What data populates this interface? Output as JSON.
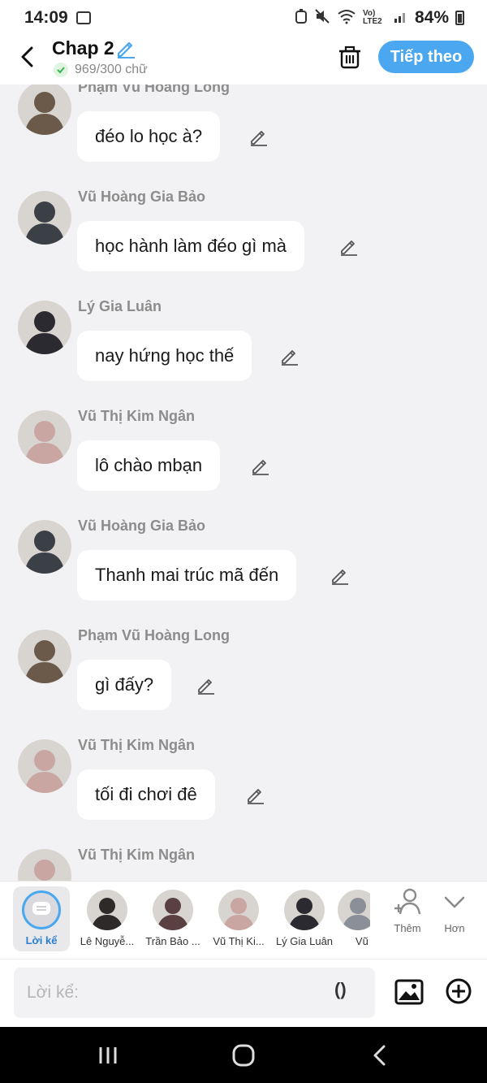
{
  "status_bar": {
    "time": "14:09",
    "network": "Vo) LTE2",
    "battery": "84%"
  },
  "header": {
    "title": "Chap 2",
    "word_count": "969/300 chữ",
    "next_label": "Tiếp theo"
  },
  "messages": [
    {
      "sender": "Phạm Vũ Hoàng Long",
      "text": "đéo lo học à?",
      "avatar_tone": "#6b5a4a"
    },
    {
      "sender": "Vũ Hoàng Gia Bảo",
      "text": "học hành làm đéo gì mà",
      "avatar_tone": "#3b3f46"
    },
    {
      "sender": "Lý Gia Luân",
      "text": "nay hứng học thế",
      "avatar_tone": "#2a2a30"
    },
    {
      "sender": "Vũ Thị Kim Ngân",
      "text": "lô chào mbạn",
      "avatar_tone": "#c9a6a1"
    },
    {
      "sender": "Vũ Hoàng Gia Bảo",
      "text": "Thanh mai trúc mã đến",
      "avatar_tone": "#3b3f46"
    },
    {
      "sender": "Phạm Vũ Hoàng Long",
      "text": "gì đấy?",
      "avatar_tone": "#6b5a4a"
    },
    {
      "sender": "Vũ Thị Kim Ngân",
      "text": "tối đi chơi đê",
      "avatar_tone": "#c9a6a1"
    },
    {
      "sender": "Vũ Thị Kim Ngân",
      "text": "",
      "avatar_tone": "#c9a6a1"
    }
  ],
  "character_bar": {
    "narrator_label": "Lời kể",
    "characters": [
      {
        "label": "Lê Nguyễ...",
        "tone": "#2e2a2a"
      },
      {
        "label": "Trần Bảo ...",
        "tone": "#5a4040"
      },
      {
        "label": "Vũ Thị Ki...",
        "tone": "#c9a6a1"
      },
      {
        "label": "Lý Gia Luân",
        "tone": "#2a2a30"
      },
      {
        "label": "Vũ Ho",
        "tone": "#8b9098"
      }
    ],
    "add_label": "Thêm",
    "more_label": "Hơn"
  },
  "input_bar": {
    "placeholder": "Lời kể:",
    "paren_label": "()"
  },
  "colors": {
    "accent": "#4aa7f0",
    "background": "#f2f2f4",
    "bubble": "#ffffff"
  }
}
